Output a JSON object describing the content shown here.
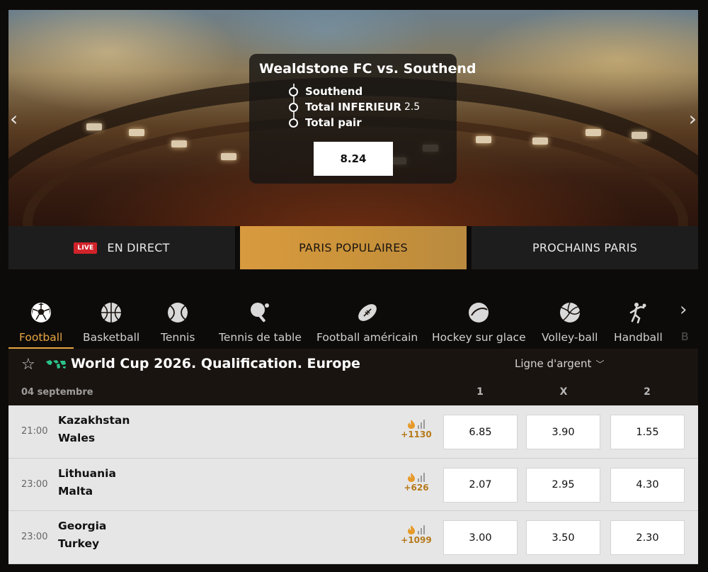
{
  "banner": {
    "prev_arrow": "‹",
    "next_arrow": "›",
    "match_title": "Wealdstone FC  vs.  Southend",
    "selections": [
      {
        "label": "Southend",
        "extra": ""
      },
      {
        "label": "Total INFERIEUR",
        "extra": "2.5"
      },
      {
        "label": "Total pair",
        "extra": ""
      }
    ],
    "combined_odds": "8.24"
  },
  "tabs": {
    "live_badge": "LIVE",
    "live_label": "EN DIRECT",
    "popular_label": "PARIS POPULAIRES",
    "next_label": "PROCHAINS PARIS"
  },
  "sports": {
    "items": [
      {
        "label": "Football",
        "icon": "soccer-ball-icon",
        "active": true
      },
      {
        "label": "Basketball",
        "icon": "basketball-icon",
        "active": false
      },
      {
        "label": "Tennis",
        "icon": "tennis-ball-icon",
        "active": false
      },
      {
        "label": "Tennis de table",
        "icon": "ping-pong-icon",
        "active": false
      },
      {
        "label": "Football américain",
        "icon": "american-football-icon",
        "active": false
      },
      {
        "label": "Hockey sur glace",
        "icon": "hockey-puck-icon",
        "active": false
      },
      {
        "label": "Volley-ball",
        "icon": "volleyball-icon",
        "active": false
      },
      {
        "label": "Handball",
        "icon": "handball-icon",
        "active": false
      }
    ],
    "next_arrow": "›",
    "cut_label": "B"
  },
  "league": {
    "title": "World Cup 2026. Qualification. Europe",
    "market": "Ligne d'argent",
    "date": "04 septembre",
    "columns": [
      "1",
      "X",
      "2"
    ]
  },
  "matches": [
    {
      "time": "21:00",
      "home": "Kazakhstan",
      "away": "Wales",
      "more": "+1130",
      "odds": [
        "6.85",
        "3.90",
        "1.55"
      ]
    },
    {
      "time": "23:00",
      "home": "Lithuania",
      "away": "Malta",
      "more": "+626",
      "odds": [
        "2.07",
        "2.95",
        "4.30"
      ]
    },
    {
      "time": "23:00",
      "home": "Georgia",
      "away": "Turkey",
      "more": "+1099",
      "odds": [
        "3.00",
        "3.50",
        "2.30"
      ]
    }
  ],
  "colors": {
    "accent": "#e6a543",
    "live_red": "#d1232a",
    "odds_more": "#b67a1c"
  }
}
